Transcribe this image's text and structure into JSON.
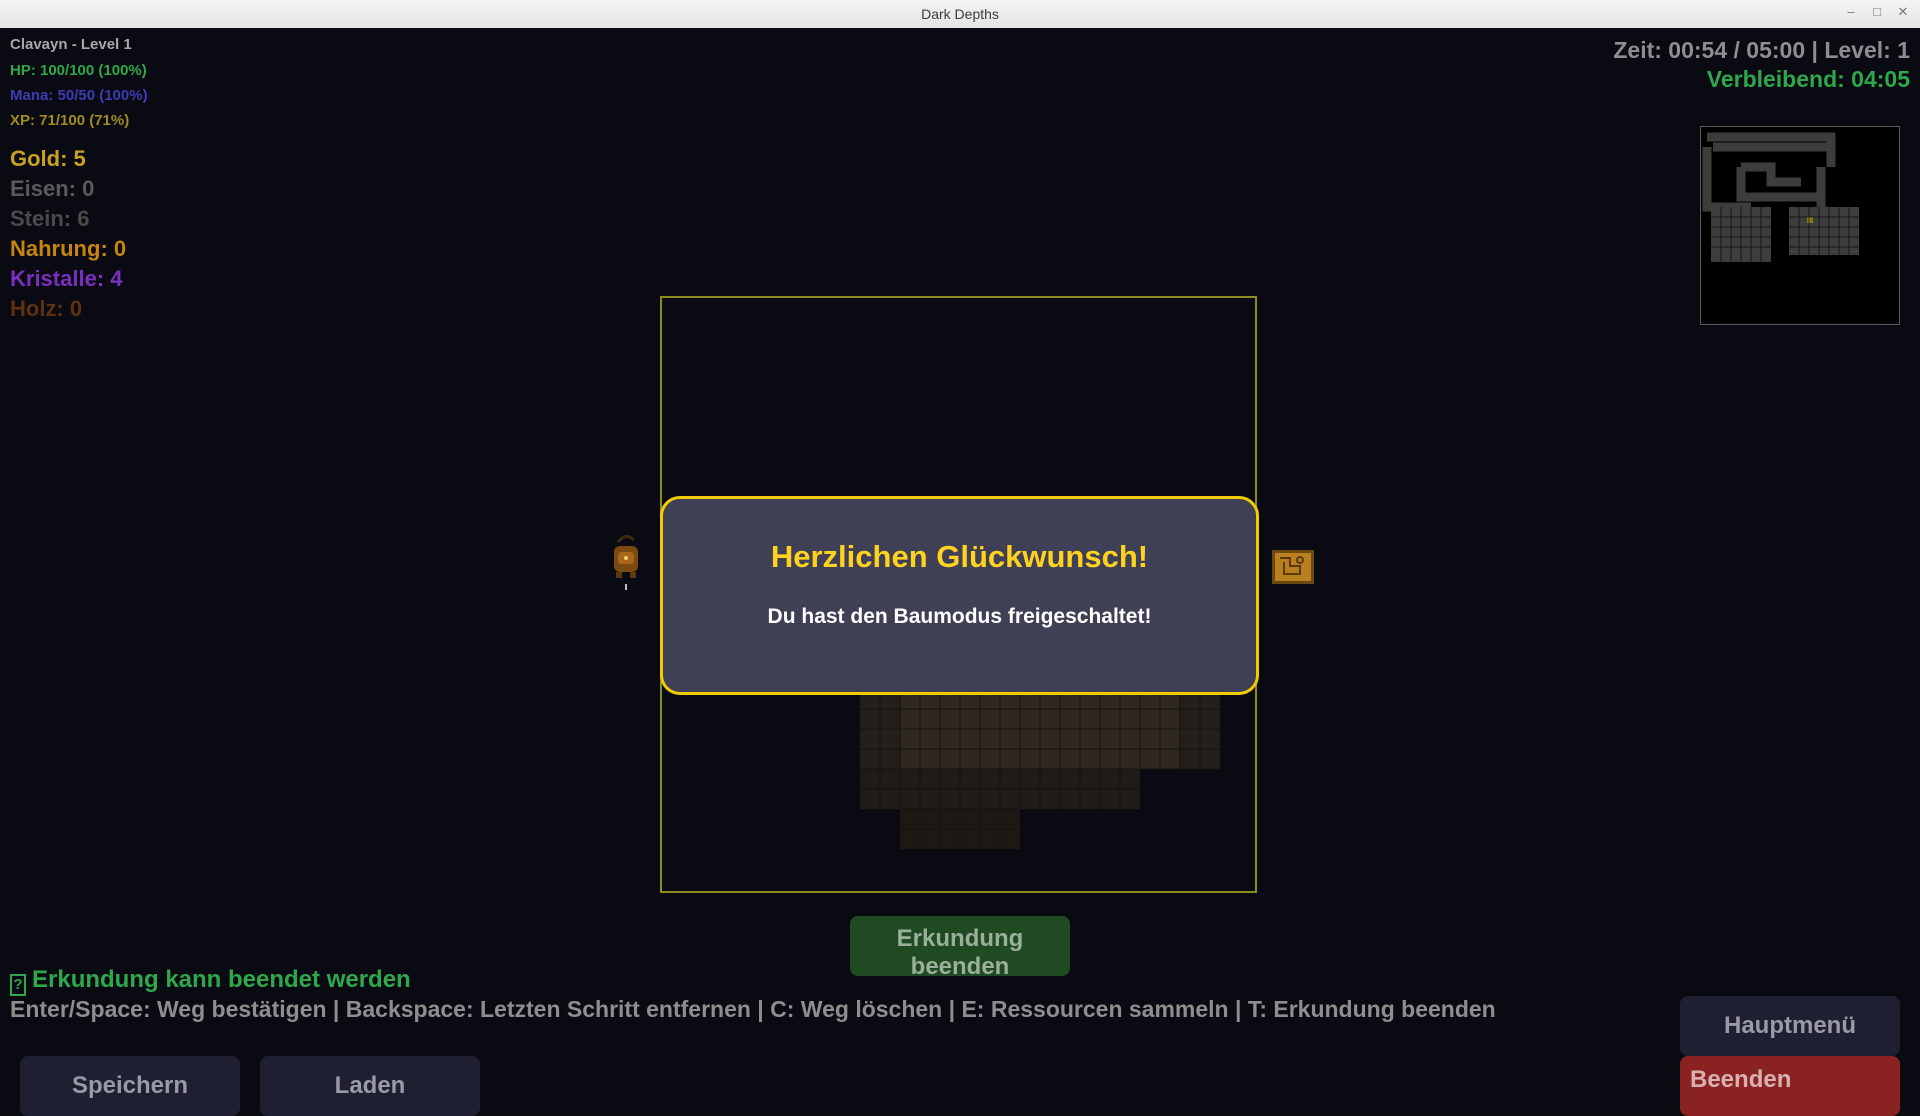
{
  "window": {
    "title": "Dark Depths"
  },
  "player": {
    "name_level": "Clavayn - Level 1",
    "hp": "HP: 100/100 (100%)",
    "mana": "Mana: 50/50 (100%)",
    "xp": "XP: 71/100 (71%)"
  },
  "resources": {
    "gold": "Gold: 5",
    "iron": "Eisen: 0",
    "stone": "Stein: 6",
    "food": "Nahrung: 0",
    "crystals": "Kristalle: 4",
    "wood": "Holz: 0"
  },
  "timer": {
    "line": "Zeit: 00:54 / 05:00 | Level: 1",
    "remaining": "Verbleibend: 04:05"
  },
  "dialog": {
    "title": "Herzlichen Glückwunsch!",
    "message": "Du hast den Baumodus freigeschaltet!"
  },
  "controls": {
    "end_exploration": "Erkundung beenden",
    "status": "Erkundung kann beendet werden",
    "hint": "Enter/Space: Weg bestätigen | Backspace: Letzten Schritt entfernen | C: Weg löschen | E: Ressourcen sammeln | T: Erkundung beenden",
    "save": "Speichern",
    "load": "Laden",
    "main_menu": "Hauptmenü",
    "quit": "Beenden"
  },
  "colors": {
    "accent_yellow": "#ffd21e",
    "gold": "#c8a21e",
    "iron": "#5a5a5a",
    "stone": "#4a4a4a",
    "food": "#c8850e",
    "crystals": "#7a2fbf",
    "wood": "#5a3212",
    "hp": "#2ea84a",
    "mana": "#3c3cb4",
    "xp": "#a08c1e",
    "remaining": "#2ea84a"
  },
  "icons": [
    "player-character-icon",
    "treasure-map-icon",
    "question-icon"
  ]
}
